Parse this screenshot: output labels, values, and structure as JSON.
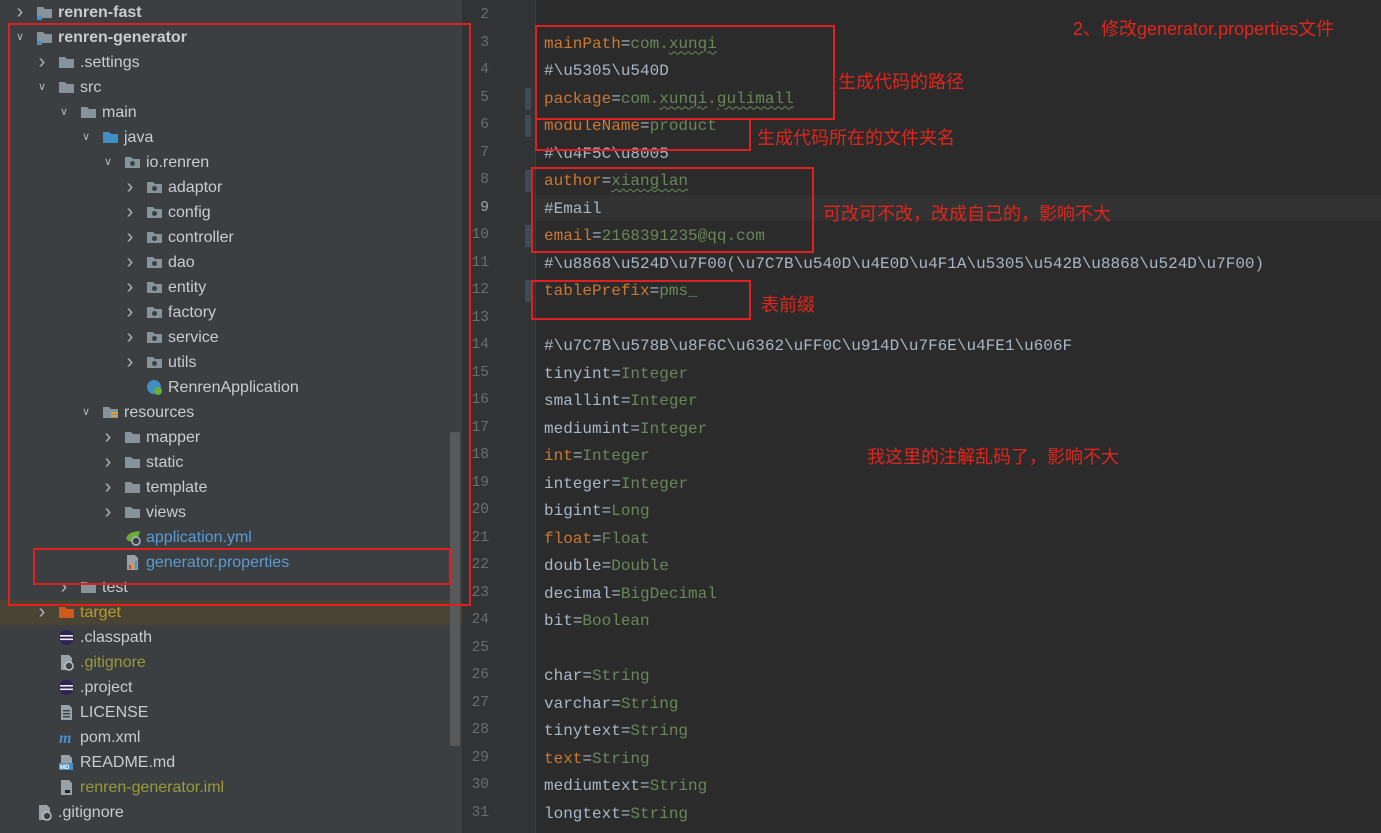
{
  "tree": {
    "items": [
      {
        "label": "renren-fast",
        "indent": 0,
        "arrow": "right",
        "icon": "module-folder",
        "style": "bold"
      },
      {
        "label": "renren-generator",
        "indent": 0,
        "arrow": "down",
        "icon": "module-folder",
        "style": "bold"
      },
      {
        "label": ".settings",
        "indent": 1,
        "arrow": "right",
        "icon": "folder"
      },
      {
        "label": "src",
        "indent": 1,
        "arrow": "down",
        "icon": "folder"
      },
      {
        "label": "main",
        "indent": 2,
        "arrow": "down",
        "icon": "folder"
      },
      {
        "label": "java",
        "indent": 3,
        "arrow": "down",
        "icon": "source-folder"
      },
      {
        "label": "io.renren",
        "indent": 4,
        "arrow": "down",
        "icon": "package"
      },
      {
        "label": "adaptor",
        "indent": 5,
        "arrow": "right",
        "icon": "package"
      },
      {
        "label": "config",
        "indent": 5,
        "arrow": "right",
        "icon": "package"
      },
      {
        "label": "controller",
        "indent": 5,
        "arrow": "right",
        "icon": "package"
      },
      {
        "label": "dao",
        "indent": 5,
        "arrow": "right",
        "icon": "package"
      },
      {
        "label": "entity",
        "indent": 5,
        "arrow": "right",
        "icon": "package"
      },
      {
        "label": "factory",
        "indent": 5,
        "arrow": "right",
        "icon": "package"
      },
      {
        "label": "service",
        "indent": 5,
        "arrow": "right",
        "icon": "package"
      },
      {
        "label": "utils",
        "indent": 5,
        "arrow": "right",
        "icon": "package"
      },
      {
        "label": "RenrenApplication",
        "indent": 5,
        "arrow": "none",
        "icon": "spring-class"
      },
      {
        "label": "resources",
        "indent": 3,
        "arrow": "down",
        "icon": "resources-folder"
      },
      {
        "label": "mapper",
        "indent": 4,
        "arrow": "right",
        "icon": "folder"
      },
      {
        "label": "static",
        "indent": 4,
        "arrow": "right",
        "icon": "folder"
      },
      {
        "label": "template",
        "indent": 4,
        "arrow": "right",
        "icon": "folder"
      },
      {
        "label": "views",
        "indent": 4,
        "arrow": "right",
        "icon": "folder"
      },
      {
        "label": "application.yml",
        "indent": 4,
        "arrow": "none",
        "icon": "yml-file",
        "style": "blue"
      },
      {
        "label": "generator.properties",
        "indent": 4,
        "arrow": "none",
        "icon": "properties-file",
        "style": "blue"
      },
      {
        "label": "test",
        "indent": 2,
        "arrow": "right",
        "icon": "folder"
      },
      {
        "label": "target",
        "indent": 1,
        "arrow": "right",
        "icon": "excluded-folder",
        "style": "target",
        "highlight": true
      },
      {
        "label": ".classpath",
        "indent": 1,
        "arrow": "none",
        "icon": "eclipse-file"
      },
      {
        "label": ".gitignore",
        "indent": 1,
        "arrow": "none",
        "icon": "ignore-file",
        "style": "olive"
      },
      {
        "label": ".project",
        "indent": 1,
        "arrow": "none",
        "icon": "eclipse-file"
      },
      {
        "label": "LICENSE",
        "indent": 1,
        "arrow": "none",
        "icon": "text-file"
      },
      {
        "label": "pom.xml",
        "indent": 1,
        "arrow": "none",
        "icon": "maven-file"
      },
      {
        "label": "README.md",
        "indent": 1,
        "arrow": "none",
        "icon": "markdown-file"
      },
      {
        "label": "renren-generator.iml",
        "indent": 1,
        "arrow": "none",
        "icon": "iml-file",
        "style": "olive"
      },
      {
        "label": ".gitignore",
        "indent": 0,
        "arrow": "none",
        "icon": "ignore-file"
      }
    ]
  },
  "editor": {
    "current_line": "9",
    "lines": [
      {
        "n": "2",
        "parts": []
      },
      {
        "n": "3",
        "parts": [
          {
            "t": "mainPath",
            "c": "k-orange"
          },
          {
            "t": "=",
            "c": "k-gray"
          },
          {
            "t": "com.",
            "c": "v-green"
          },
          {
            "t": "xunqi",
            "c": "v-green wavy"
          }
        ]
      },
      {
        "n": "4",
        "parts": [
          {
            "t": "#\\u5305\\u540D",
            "c": "k-comment"
          }
        ]
      },
      {
        "n": "5",
        "parts": [
          {
            "t": "package",
            "c": "k-orange"
          },
          {
            "t": "=",
            "c": "k-gray"
          },
          {
            "t": "com.",
            "c": "v-green"
          },
          {
            "t": "xunqi",
            "c": "v-green wavy"
          },
          {
            "t": ".",
            "c": "v-green"
          },
          {
            "t": "gulimall",
            "c": "v-green wavy"
          }
        ]
      },
      {
        "n": "6",
        "parts": [
          {
            "t": "moduleName",
            "c": "k-orange"
          },
          {
            "t": "=",
            "c": "k-gray"
          },
          {
            "t": "product",
            "c": "v-green"
          }
        ]
      },
      {
        "n": "7",
        "parts": [
          {
            "t": "#\\u4F5C\\u8005",
            "c": "k-comment"
          }
        ]
      },
      {
        "n": "8",
        "parts": [
          {
            "t": "author",
            "c": "k-orange"
          },
          {
            "t": "=",
            "c": "k-gray"
          },
          {
            "t": "xianglan",
            "c": "v-green wavy"
          }
        ]
      },
      {
        "n": "9",
        "parts": [
          {
            "t": "#Email",
            "c": "k-comment"
          }
        ]
      },
      {
        "n": "10",
        "parts": [
          {
            "t": "email",
            "c": "k-orange"
          },
          {
            "t": "=",
            "c": "k-gray"
          },
          {
            "t": "2168391235@qq.com",
            "c": "v-green"
          }
        ]
      },
      {
        "n": "11",
        "parts": [
          {
            "t": "#\\u8868\\u524D\\u7F00(\\u7C7B\\u540D\\u4E0D\\u4F1A\\u5305\\u542B\\u8868\\u524D\\u7F00)",
            "c": "k-comment"
          }
        ]
      },
      {
        "n": "12",
        "parts": [
          {
            "t": "tablePrefix",
            "c": "k-orange"
          },
          {
            "t": "=",
            "c": "k-gray"
          },
          {
            "t": "pms_",
            "c": "v-green"
          }
        ]
      },
      {
        "n": "13",
        "parts": []
      },
      {
        "n": "14",
        "parts": [
          {
            "t": "#\\u7C7B\\u578B\\u8F6C\\u6362\\uFF0C\\u914D\\u7F6E\\u4FE1\\u606F",
            "c": "k-comment"
          }
        ]
      },
      {
        "n": "15",
        "parts": [
          {
            "t": "tinyint",
            "c": "k-gray"
          },
          {
            "t": "=",
            "c": "k-gray"
          },
          {
            "t": "Integer",
            "c": "v-green"
          }
        ]
      },
      {
        "n": "16",
        "parts": [
          {
            "t": "smallint",
            "c": "k-gray"
          },
          {
            "t": "=",
            "c": "k-gray"
          },
          {
            "t": "Integer",
            "c": "v-green"
          }
        ]
      },
      {
        "n": "17",
        "parts": [
          {
            "t": "mediumint",
            "c": "k-gray"
          },
          {
            "t": "=",
            "c": "k-gray"
          },
          {
            "t": "Integer",
            "c": "v-green"
          }
        ]
      },
      {
        "n": "18",
        "parts": [
          {
            "t": "int",
            "c": "k-orange"
          },
          {
            "t": "=",
            "c": "k-gray"
          },
          {
            "t": "Integer",
            "c": "v-green"
          }
        ]
      },
      {
        "n": "19",
        "parts": [
          {
            "t": "integer",
            "c": "k-gray"
          },
          {
            "t": "=",
            "c": "k-gray"
          },
          {
            "t": "Integer",
            "c": "v-green"
          }
        ]
      },
      {
        "n": "20",
        "parts": [
          {
            "t": "bigint",
            "c": "k-gray"
          },
          {
            "t": "=",
            "c": "k-gray"
          },
          {
            "t": "Long",
            "c": "v-green"
          }
        ]
      },
      {
        "n": "21",
        "parts": [
          {
            "t": "float",
            "c": "k-orange"
          },
          {
            "t": "=",
            "c": "k-gray"
          },
          {
            "t": "Float",
            "c": "v-green"
          }
        ]
      },
      {
        "n": "22",
        "parts": [
          {
            "t": "double",
            "c": "k-gray"
          },
          {
            "t": "=",
            "c": "k-gray"
          },
          {
            "t": "Double",
            "c": "v-green"
          }
        ]
      },
      {
        "n": "23",
        "parts": [
          {
            "t": "decimal",
            "c": "k-gray"
          },
          {
            "t": "=",
            "c": "k-gray"
          },
          {
            "t": "BigDecimal",
            "c": "v-green"
          }
        ]
      },
      {
        "n": "24",
        "parts": [
          {
            "t": "bit",
            "c": "k-gray"
          },
          {
            "t": "=",
            "c": "k-gray"
          },
          {
            "t": "Boolean",
            "c": "v-green"
          }
        ]
      },
      {
        "n": "25",
        "parts": []
      },
      {
        "n": "26",
        "parts": [
          {
            "t": "char",
            "c": "k-gray"
          },
          {
            "t": "=",
            "c": "k-gray"
          },
          {
            "t": "String",
            "c": "v-green"
          }
        ]
      },
      {
        "n": "27",
        "parts": [
          {
            "t": "varchar",
            "c": "k-gray"
          },
          {
            "t": "=",
            "c": "k-gray"
          },
          {
            "t": "String",
            "c": "v-green"
          }
        ]
      },
      {
        "n": "28",
        "parts": [
          {
            "t": "tinytext",
            "c": "k-gray"
          },
          {
            "t": "=",
            "c": "k-gray"
          },
          {
            "t": "String",
            "c": "v-green"
          }
        ]
      },
      {
        "n": "29",
        "parts": [
          {
            "t": "text",
            "c": "k-orange"
          },
          {
            "t": "=",
            "c": "k-gray"
          },
          {
            "t": "String",
            "c": "v-green"
          }
        ]
      },
      {
        "n": "30",
        "parts": [
          {
            "t": "mediumtext",
            "c": "k-gray"
          },
          {
            "t": "=",
            "c": "k-gray"
          },
          {
            "t": "String",
            "c": "v-green"
          }
        ]
      },
      {
        "n": "31",
        "parts": [
          {
            "t": "longtext",
            "c": "k-gray"
          },
          {
            "t": "=",
            "c": "k-gray"
          },
          {
            "t": "String",
            "c": "v-green"
          }
        ]
      }
    ]
  },
  "annotations": {
    "title": "2、修改generator.properties文件",
    "path_note": "生成代码的路径",
    "module_note": "生成代码所在的文件夹名",
    "author_note": "可改可不改，改成自己的，影响不大",
    "prefix_note": "表前缀",
    "garbled_note": "我这里的注解乱码了，影响不大",
    "color": "#e02020"
  }
}
